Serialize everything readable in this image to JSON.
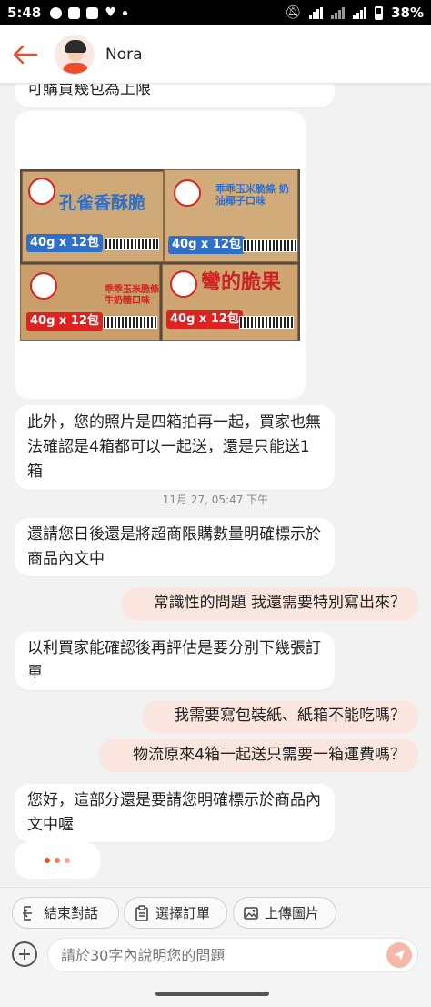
{
  "status_bar": {
    "time": "5:48",
    "battery": "38%"
  },
  "header": {
    "contact_name": "Nora"
  },
  "messages": [
    {
      "side": "in",
      "text": "可購買幾包為上限"
    },
    {
      "side": "in",
      "text": "此外，您的照片是四箱拍再一起，買家也無法確認是4箱都可以一起送，還是只能送1箱"
    },
    {
      "side": "in",
      "text": "還請您日後還是將超商限購數量明確標示於商品內文中"
    },
    {
      "side": "out",
      "text": "常識性的問題 我還需要特別寫出來？"
    },
    {
      "side": "in",
      "text": "以利買家能確認後再評估是要分別下幾張訂單"
    },
    {
      "side": "out",
      "text": "我需要寫包裝紙、紙箱不能吃嗎？"
    },
    {
      "side": "out",
      "text": "物流原來4箱一起送只需要一箱運費嗎？"
    },
    {
      "side": "in",
      "text": "您好，這部分還是要請您明確標示於商品內文中喔"
    }
  ],
  "timestamp": "11月 27, 05:47 下午",
  "photo": {
    "boxes": [
      {
        "title": "孔雀香酥脆",
        "weight": "40g x 12包"
      },
      {
        "title": "乖乖玉米脆條 奶油椰子口味",
        "weight": "40g x 12包"
      },
      {
        "title": "乖乖玉米脆條 牛奶糖口味",
        "weight": "40g x 12包"
      },
      {
        "title": "彎的脆果",
        "weight": "40g x 12包"
      }
    ],
    "brand": "乖乖"
  },
  "quick_actions": {
    "end_chat": "結束對話",
    "select_order": "選擇訂單",
    "upload_image": "上傳圖片"
  },
  "input": {
    "placeholder": "請於30字內說明您的問題"
  },
  "colors": {
    "accent": "#ee4d2d",
    "outgoing_bubble": "#fbe6df",
    "incoming_bubble": "#ffffff"
  }
}
